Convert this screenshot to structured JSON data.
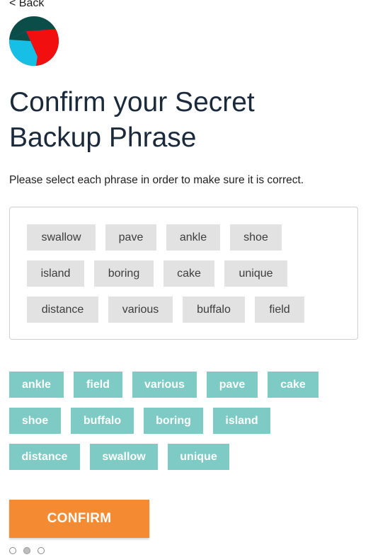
{
  "nav": {
    "back_label": "< Back"
  },
  "logo": {
    "name": "app-logo",
    "colors": [
      "#0b4d48",
      "#17bfe6",
      "#f10f0f"
    ]
  },
  "header": {
    "title_line1": "Confirm your Secret",
    "title_line2": "Backup Phrase"
  },
  "instructions": "Please select each phrase in order to make sure it is correct.",
  "selected_phrases": [
    "swallow",
    "pave",
    "ankle",
    "shoe",
    "island",
    "boring",
    "cake",
    "unique",
    "distance",
    "various",
    "buffalo",
    "field"
  ],
  "word_bank": [
    "ankle",
    "field",
    "various",
    "pave",
    "cake",
    "shoe",
    "buffalo",
    "boring",
    "island",
    "distance",
    "swallow",
    "unique"
  ],
  "confirm_label": "CONFIRM",
  "pagination": {
    "total": 3,
    "current": 2
  },
  "colors": {
    "accent": "#f48b32",
    "chip_teal": "#7dcbc4",
    "chip_gray": "#e2e2e2",
    "title": "#1b2a3b"
  }
}
